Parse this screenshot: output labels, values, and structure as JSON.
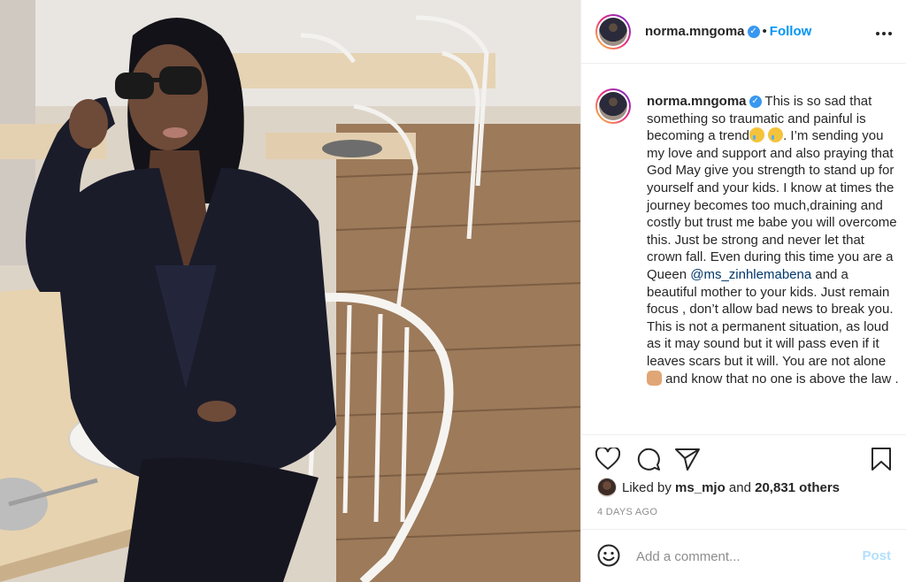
{
  "post": {
    "image_alt": "Woman in black blazer and sunglasses seated at a café table"
  },
  "header": {
    "username": "norma.mngoma",
    "separator": "•",
    "follow_label": "Follow",
    "more_label": "•••"
  },
  "caption": {
    "username": "norma.mngoma",
    "part1": " This is so sad that something so traumatic and painful is becoming a trend",
    "part2": ". I’m sending you my love and support and also praying that God May give you strength to stand up for yourself and your kids. I know at times the journey becomes too much,draining and costly but trust me babe you will overcome this. Just be strong and never let that crown fall. Even during this time you are a Queen ",
    "mention": "@ms_zinhlemabena",
    "part3": " and a beautiful mother to your kids. Just remain focus , don’t allow bad news to break you. This is not a permanent situation, as loud as it may sound but it will pass even if it leaves scars but it will. You are not alone ",
    "part4": " and know that no one is above the law ."
  },
  "likes": {
    "prefix": "Liked by ",
    "user": "ms_mjo",
    "and": " and ",
    "others": "20,831 others"
  },
  "time_ago": "4 DAYS AGO",
  "comment": {
    "placeholder": "Add a comment...",
    "post_label": "Post"
  },
  "icons": {
    "like": "heart-icon",
    "comment": "comment-icon",
    "share": "share-icon",
    "save": "bookmark-icon",
    "emoji": "smiley-icon"
  },
  "colors": {
    "accent": "#0095f6",
    "verified": "#3897f0",
    "post_disabled": "#b2dffc",
    "secondary_text": "#8e8e8e"
  }
}
